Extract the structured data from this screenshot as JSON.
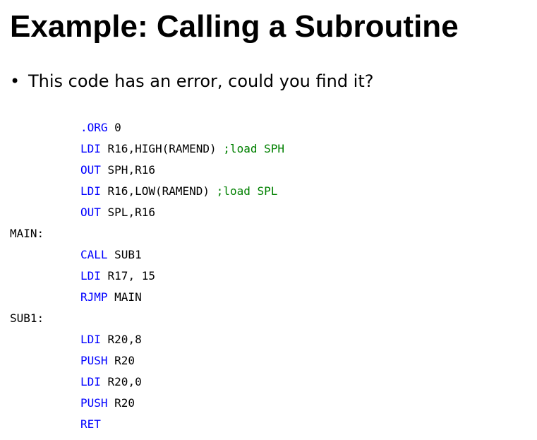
{
  "slide": {
    "title": "Example: Calling a Subroutine",
    "bullet": "This code has an error, could you find it?",
    "bullet_marker": "•"
  },
  "code": {
    "lines": [
      {
        "kind": "instr",
        "keyword": ".ORG",
        "operands": " 0",
        "comment": ""
      },
      {
        "kind": "instr",
        "keyword": "LDI",
        "operands": " R16,HIGH(RAMEND) ",
        "comment": ";load SPH"
      },
      {
        "kind": "instr",
        "keyword": "OUT",
        "operands": " SPH,R16",
        "comment": ""
      },
      {
        "kind": "instr",
        "keyword": "LDI",
        "operands": " R16,LOW(RAMEND) ",
        "comment": ";load SPL"
      },
      {
        "kind": "instr",
        "keyword": "OUT",
        "operands": " SPL,R16",
        "comment": ""
      },
      {
        "kind": "label",
        "text": "MAIN:"
      },
      {
        "kind": "instr",
        "keyword": "CALL",
        "operands": " SUB1",
        "comment": ""
      },
      {
        "kind": "instr",
        "keyword": "LDI",
        "operands": " R17, 15",
        "comment": ""
      },
      {
        "kind": "instr",
        "keyword": "RJMP",
        "operands": " MAIN",
        "comment": ""
      },
      {
        "kind": "label",
        "text": "SUB1:"
      },
      {
        "kind": "instr",
        "keyword": "LDI",
        "operands": " R20,8",
        "comment": ""
      },
      {
        "kind": "instr",
        "keyword": "PUSH",
        "operands": " R20",
        "comment": ""
      },
      {
        "kind": "instr",
        "keyword": "LDI",
        "operands": " R20,0",
        "comment": ""
      },
      {
        "kind": "instr",
        "keyword": "PUSH",
        "operands": " R20",
        "comment": ""
      },
      {
        "kind": "instr",
        "keyword": "RET",
        "operands": "",
        "comment": ""
      }
    ]
  },
  "colors": {
    "keyword": "#0000ff",
    "comment": "#008000",
    "text": "#000000"
  }
}
